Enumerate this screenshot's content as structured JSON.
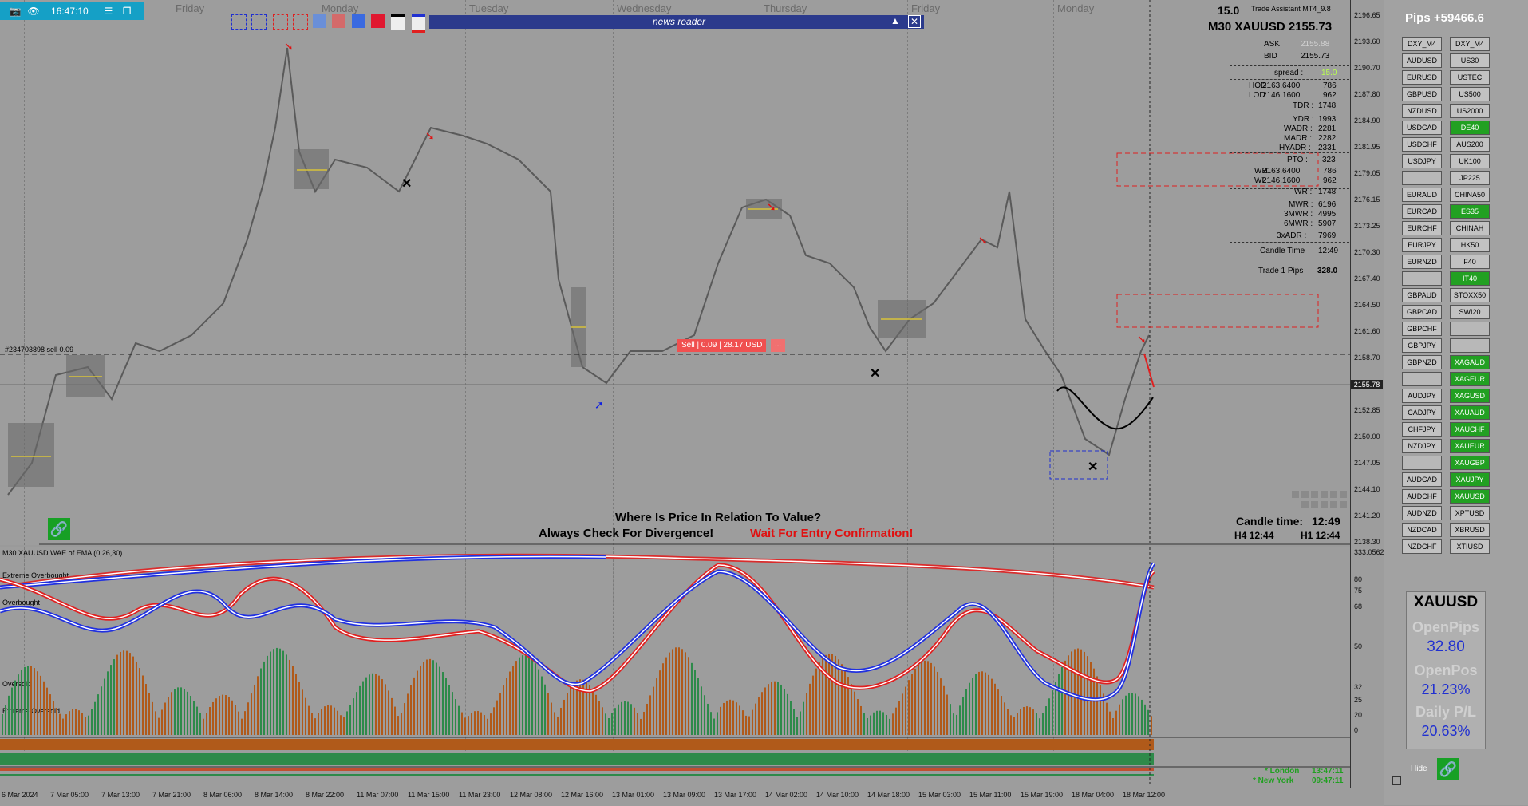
{
  "toolbar": {
    "time": "16:47:10"
  },
  "news": {
    "title": "news reader"
  },
  "days": [
    "Friday",
    "Monday",
    "Tuesday",
    "Wednesday",
    "Thursday",
    "Friday",
    "Monday"
  ],
  "header": {
    "spread_value": "15.0",
    "ea_name": "Trade Assistant MT4_9.8",
    "symbol_line": "M30 XAUUSD 2155.73"
  },
  "stats": [
    {
      "label": "ASK",
      "value": "2155.88"
    },
    {
      "label": "BID",
      "value": "2155.73"
    },
    {
      "label": "spread :",
      "value": "15.0"
    },
    {
      "label": "HOD",
      "value": "2163.6400",
      "extra": "786"
    },
    {
      "label": "LOD",
      "value": "2146.1600",
      "extra": "962"
    },
    {
      "label": "TDR :",
      "value": "1748"
    },
    {
      "label": "YDR :",
      "value": "1993"
    },
    {
      "label": "WADR :",
      "value": "2281"
    },
    {
      "label": "MADR :",
      "value": "2282"
    },
    {
      "label": "HYADR :",
      "value": "2331"
    },
    {
      "label": "PTO :",
      "value": "323"
    },
    {
      "label": "WH",
      "value": "2163.6400",
      "extra": "786"
    },
    {
      "label": "WL",
      "value": "2146.1600",
      "extra": "962"
    },
    {
      "label": "WR :",
      "value": "1748"
    },
    {
      "label": "MWR :",
      "value": "6196"
    },
    {
      "label": "3MWR :",
      "value": "4995"
    },
    {
      "label": "6MWR :",
      "value": "5907"
    },
    {
      "label": "3xADR :",
      "value": "7969"
    }
  ],
  "candle_time": {
    "label": "Candle Time",
    "value": "12:49"
  },
  "trade_pips": {
    "label": "Trade 1 Pips",
    "value": "328.0"
  },
  "order": {
    "line_label": "#234703898 sell 0.09",
    "tag": "Sell | 0.09 | 28.17 USD",
    "close": "..."
  },
  "messages": {
    "line1": "Where Is Price In Relation To Value?",
    "line2": "Always Check For Divergence!",
    "line3": "Wait For Entry Confirmation!"
  },
  "candle_box": {
    "label": "Candle time:",
    "value": "12:49",
    "h4": "H4 12:44",
    "h1": "H1 12:44"
  },
  "price_ticks": [
    "2196.65",
    "2193.60",
    "2190.70",
    "2187.80",
    "2184.90",
    "2181.95",
    "2179.05",
    "2176.15",
    "2173.25",
    "2170.30",
    "2167.40",
    "2164.50",
    "2161.60",
    "2158.70",
    "2155.78",
    "2152.85",
    "2150.00",
    "2147.05",
    "2144.10",
    "2141.20",
    "2138.30"
  ],
  "current_price": "2155.78",
  "indicator": {
    "title": "M30 XAUUSD WAE of EMA (0.26,30)",
    "levels": [
      "Extreme Overbought",
      "Overbought",
      "Oversold",
      "Extreme Oversold"
    ],
    "scale": [
      "333.0562",
      "80",
      "75",
      "68",
      "50",
      "32",
      "25",
      "20",
      "0"
    ]
  },
  "sessions": [
    {
      "name": "* London",
      "time": "13:47:11"
    },
    {
      "name": "* New York",
      "time": "09:47:11"
    }
  ],
  "time_labels": [
    "6 Mar 2024",
    "7 Mar 05:00",
    "7 Mar 13:00",
    "7 Mar 21:00",
    "8 Mar 06:00",
    "8 Mar 14:00",
    "8 Mar 22:00",
    "11 Mar 07:00",
    "11 Mar 15:00",
    "11 Mar 23:00",
    "12 Mar 08:00",
    "12 Mar 16:00",
    "13 Mar 01:00",
    "13 Mar 09:00",
    "13 Mar 17:00",
    "14 Mar 02:00",
    "14 Mar 10:00",
    "14 Mar 18:00",
    "15 Mar 03:00",
    "15 Mar 11:00",
    "15 Mar 19:00",
    "18 Mar 04:00",
    "18 Mar 12:00"
  ],
  "panel": {
    "pips_title": "Pips +59466.6",
    "left_symbols": [
      "DXY_M4",
      "AUDUSD",
      "EURUSD",
      "GBPUSD",
      "NZDUSD",
      "USDCAD",
      "USDCHF",
      "USDJPY",
      "",
      "EURAUD",
      "EURCAD",
      "EURCHF",
      "EURJPY",
      "EURNZD",
      "",
      "GBPAUD",
      "GBPCAD",
      "GBPCHF",
      "GBPJPY",
      "GBPNZD",
      "",
      "AUDJPY",
      "CADJPY",
      "CHFJPY",
      "NZDJPY",
      "",
      "AUDCAD",
      "AUDCHF",
      "AUDNZD",
      "NZDCAD",
      "NZDCHF"
    ],
    "right_symbols": [
      {
        "s": "DXY_M4",
        "g": false
      },
      {
        "s": "US30",
        "g": false
      },
      {
        "s": "USTEC",
        "g": false
      },
      {
        "s": "US500",
        "g": false
      },
      {
        "s": "US2000",
        "g": false
      },
      {
        "s": "DE40",
        "g": true
      },
      {
        "s": "AUS200",
        "g": false
      },
      {
        "s": "UK100",
        "g": false
      },
      {
        "s": "JP225",
        "g": false
      },
      {
        "s": "CHINA50",
        "g": false
      },
      {
        "s": "ES35",
        "g": true
      },
      {
        "s": "CHINAH",
        "g": false
      },
      {
        "s": "HK50",
        "g": false
      },
      {
        "s": "F40",
        "g": false
      },
      {
        "s": "IT40",
        "g": true
      },
      {
        "s": "STOXX50",
        "g": false
      },
      {
        "s": "SWI20",
        "g": false
      },
      {
        "s": "",
        "g": false
      },
      {
        "s": "",
        "g": false
      },
      {
        "s": "XAGAUD",
        "g": true
      },
      {
        "s": "XAGEUR",
        "g": true
      },
      {
        "s": "XAGUSD",
        "g": true
      },
      {
        "s": "XAUAUD",
        "g": true
      },
      {
        "s": "XAUCHF",
        "g": true
      },
      {
        "s": "XAUEUR",
        "g": true
      },
      {
        "s": "XAUGBP",
        "g": true
      },
      {
        "s": "XAUJPY",
        "g": true
      },
      {
        "s": "XAUUSD",
        "g": true
      },
      {
        "s": "XPTUSD",
        "g": false
      },
      {
        "s": "XBRUSD",
        "g": false
      },
      {
        "s": "XTIUSD",
        "g": false
      }
    ],
    "box_symbol": "XAUUSD",
    "open_pips_label": "OpenPips",
    "open_pips": "32.80",
    "open_pos_label": "OpenPos",
    "open_pos": "21.23%",
    "daily_label": "Daily P/L",
    "daily": "20.63%",
    "hide": "Hide"
  }
}
